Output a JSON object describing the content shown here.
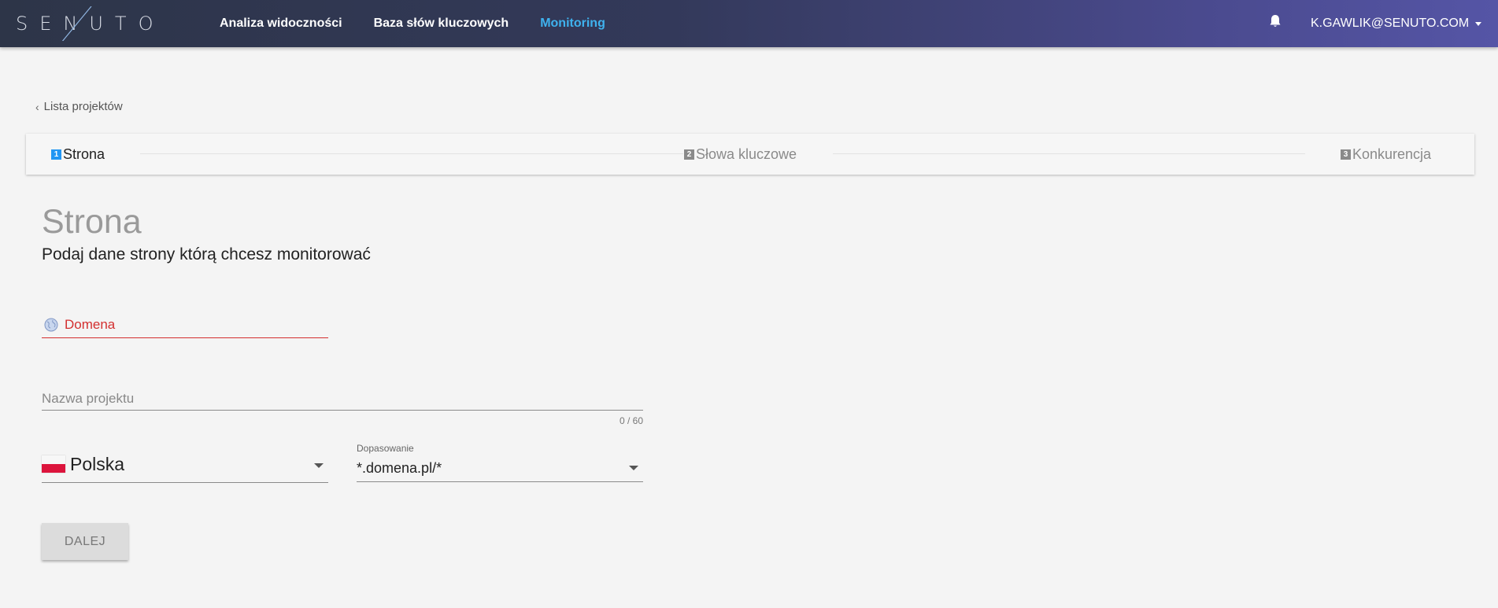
{
  "header": {
    "logo_text": "SENUTO",
    "nav": [
      {
        "label": "Analiza widoczności",
        "active": false
      },
      {
        "label": "Baza słów kluczowych",
        "active": false
      },
      {
        "label": "Monitoring",
        "active": true
      }
    ],
    "notification_icon": "bell-icon",
    "user_email": "K.GAWLIK@SENUTO.COM"
  },
  "breadcrumb": {
    "back_label": "Lista projektów"
  },
  "stepper": {
    "steps": [
      {
        "number": "1",
        "label": "Strona",
        "active": true
      },
      {
        "number": "2",
        "label": "Słowa kluczowe",
        "active": false
      },
      {
        "number": "3",
        "label": "Konkurencja",
        "active": false
      }
    ]
  },
  "page": {
    "title": "Strona",
    "subtitle": "Podaj dane strony którą chcesz monitorować"
  },
  "form": {
    "domain_label": "Domena",
    "domain_icon": "globe-icon",
    "project_name_label": "Nazwa projektu",
    "project_name_value": "",
    "project_name_counter": "0 / 60",
    "country_value": "Polska",
    "country_flag": "poland-flag-icon",
    "match_label": "Dopasowanie",
    "match_value": "*.domena.pl/*",
    "next_button": "DALEJ"
  },
  "colors": {
    "nav_active": "#3fb2ee",
    "step_active": "#2196f3",
    "error": "#d32f2f"
  }
}
